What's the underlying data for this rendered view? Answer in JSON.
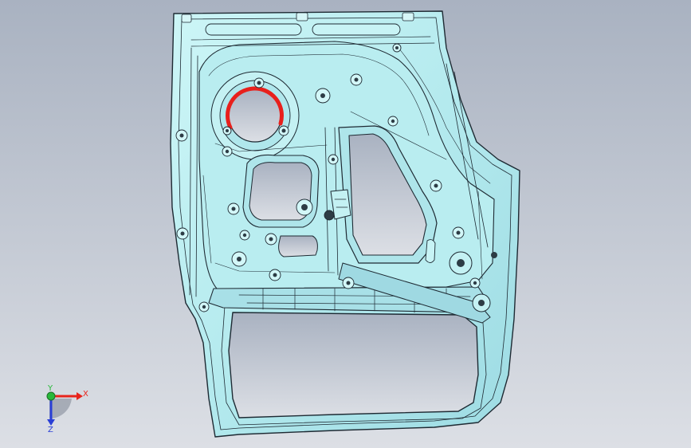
{
  "viewport": {
    "background_top": "#a9b2c1",
    "background_bottom": "#dcdfe5"
  },
  "part": {
    "surface_color": "#bff0f2",
    "surface_shade": "#8fd4dc",
    "edge_color": "#1e2a33",
    "highlight_color": "#e8201c",
    "highlighted_feature": "speaker-hole-edge"
  },
  "triad": {
    "x_label": "X",
    "y_label": "Y",
    "z_label": "Z",
    "x_color": "#e8241c",
    "y_color": "#28b83a",
    "z_color": "#2a3fd6"
  }
}
